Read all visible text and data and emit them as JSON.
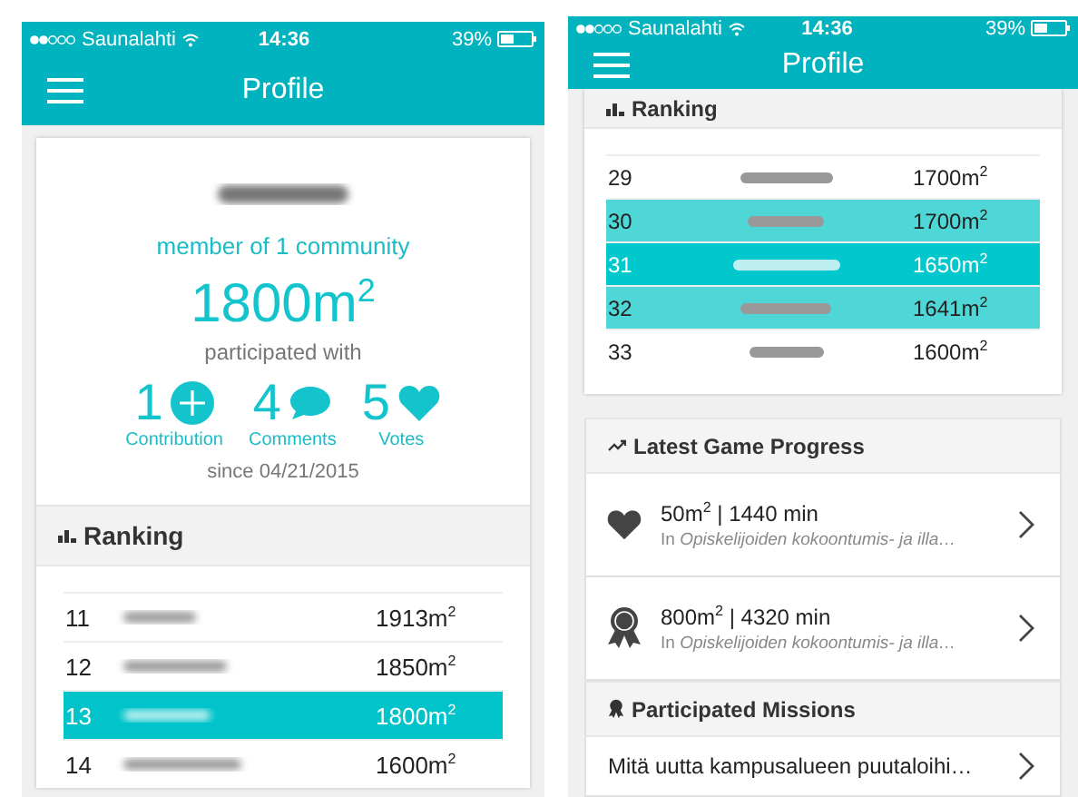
{
  "screens": [
    {
      "status_bar": {
        "carrier": "Saunalahti",
        "time": "14:36",
        "battery": "39%"
      },
      "nav": {
        "title": "Profile"
      },
      "profile": {
        "membership": "member of 1 community",
        "area": "1800m$^{2}$",
        "caption": "participated with",
        "stats": [
          {
            "value": "1",
            "label": "Contribution",
            "kind": "plus"
          },
          {
            "value": "4",
            "label": "Comments",
            "kind": "comment"
          },
          {
            "value": "5",
            "label": "Votes",
            "kind": "heart"
          }
        ],
        "since": "since 04/21/2015"
      },
      "ranking": {
        "title": "Ranking",
        "rows": [
          {
            "rank": "11",
            "score": "1913m$^{2}$",
            "selected": false,
            "color": "#ffffff"
          },
          {
            "rank": "12",
            "score": "1850m$^{2}$",
            "selected": false,
            "color": "#ffffff"
          },
          {
            "rank": "13",
            "score": "1800m$^{2}$",
            "selected": true,
            "color": "#00c4c9"
          },
          {
            "rank": "14",
            "score": "1600m$^{2}$",
            "selected": false,
            "color": "#ffffff"
          }
        ]
      }
    },
    {
      "status_bar": {
        "carrier": "Saunalahti",
        "time": "14:36",
        "battery": "39%"
      },
      "nav": {
        "title": "Profile"
      },
      "ranking": {
        "title": "Ranking",
        "rows": [
          {
            "rank": "29",
            "score": "1700m$^{2}$",
            "selected": false,
            "color": "#ffffff"
          },
          {
            "rank": "30",
            "score": "1700m$^{2}$",
            "selected": false,
            "color": "#4fd6d6"
          },
          {
            "rank": "31",
            "score": "1650m$^{2}$",
            "selected": true,
            "color": "#00c8cc"
          },
          {
            "rank": "32",
            "score": "1641m$^{2}$",
            "selected": false,
            "color": "#4fd6d6"
          },
          {
            "rank": "33",
            "score": "1600m$^{2}$",
            "selected": false,
            "color": "#ffffff"
          }
        ]
      },
      "progress": {
        "title": "Latest Game Progress",
        "items": [
          {
            "kind": "heart",
            "headline": "50m$^{2}$ | 1440 min",
            "detail": "In *Opiskelijoiden kokoontumis- ja illa…*"
          },
          {
            "kind": "medal",
            "headline": "800m$^{2}$ | 4320 min",
            "detail": "In *Opiskelijoiden kokoontumis- ja illa…*"
          }
        ]
      },
      "missions": {
        "title": "Participated Missions",
        "items": [
          {
            "text": "Mitä uutta kampusalueen puutaloihi…"
          }
        ]
      }
    }
  ]
}
